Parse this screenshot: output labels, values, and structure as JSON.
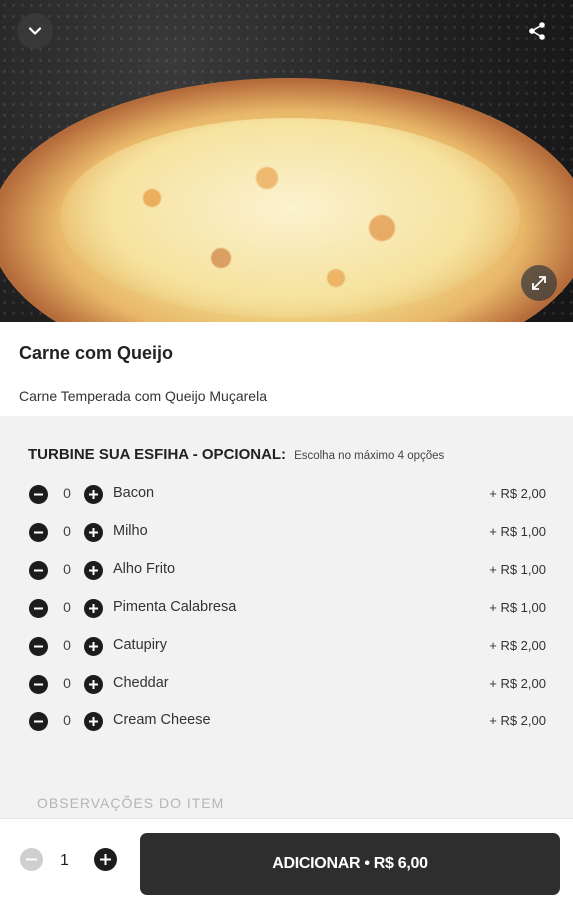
{
  "product": {
    "title": "Carne com Queijo",
    "description": "Carne Temperada com Queijo Muçarela"
  },
  "options_group": {
    "title": "TURBINE SUA ESFIHA - OPCIONAL:",
    "hint": "Escolha no máximo 4 opções",
    "items": [
      {
        "name": "Bacon",
        "qty": "0",
        "price": "+ R$ 2,00"
      },
      {
        "name": "Milho",
        "qty": "0",
        "price": "+ R$ 1,00"
      },
      {
        "name": "Alho Frito",
        "qty": "0",
        "price": "+ R$ 1,00"
      },
      {
        "name": "Pimenta Calabresa",
        "qty": "0",
        "price": "+ R$ 1,00"
      },
      {
        "name": "Catupiry",
        "qty": "0",
        "price": "+ R$ 2,00"
      },
      {
        "name": "Cheddar",
        "qty": "0",
        "price": "+ R$ 2,00"
      },
      {
        "name": "Cream Cheese",
        "qty": "0",
        "price": "+ R$ 2,00"
      }
    ]
  },
  "notes_label": "OBSERVAÇÕES DO ITEM",
  "footer": {
    "quantity": "1",
    "add_button": "ADICIONAR • R$ 6,00"
  },
  "icons": {
    "back": "chevron-down-icon",
    "share": "share-icon",
    "expand": "expand-icon",
    "minus": "minus-circle-icon",
    "plus": "plus-circle-icon"
  },
  "colors": {
    "options_bg": "#f2f2f2",
    "button_bg": "#2e2e2e",
    "icon_dark": "#1c1c1c",
    "icon_disabled": "#cfcfcf"
  }
}
